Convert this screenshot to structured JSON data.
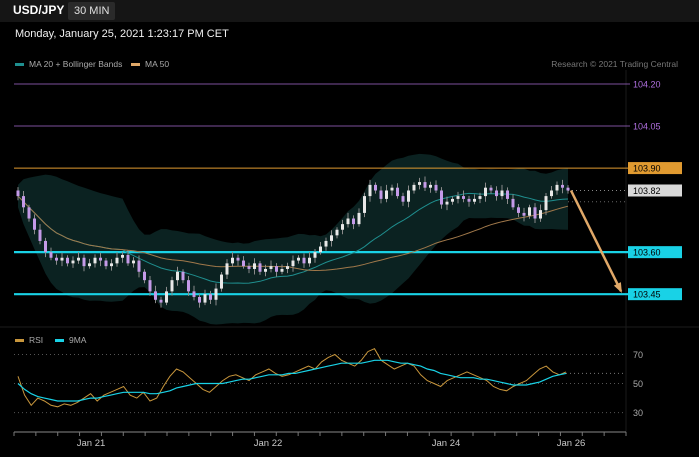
{
  "header": {
    "pair": "USD/JPY",
    "timeframe": "30 MIN"
  },
  "timestamp": "Monday, January 25, 2021 1:23:17 PM CET",
  "main_legend": [
    {
      "label": "MA 20 + Bollinger Bands",
      "color": "#1f8f8f"
    },
    {
      "label": "MA 50",
      "color": "#e0a868"
    }
  ],
  "credit": "Research © 2021 Trading Central",
  "rsi_legend": [
    {
      "label": "RSI",
      "color": "#c8963c"
    },
    {
      "label": "9MA",
      "color": "#19d2e6"
    }
  ],
  "x_axis_labels": [
    "Jan 21",
    "Jan 22",
    "Jan 24",
    "Jan 26"
  ],
  "chart_data": [
    {
      "type": "candlestick",
      "title": "USD/JPY",
      "timeframe": "30 MIN",
      "ylim": [
        103.34,
        104.25
      ],
      "levels": [
        {
          "value": 104.2,
          "label": "104.20",
          "color": "#b070e0",
          "style": "thin"
        },
        {
          "value": 104.05,
          "label": "104.05",
          "color": "#b070e0",
          "style": "thin"
        },
        {
          "value": 103.9,
          "label": "103.90",
          "color": "#e09a30",
          "style": "resistance"
        },
        {
          "value": 103.82,
          "label": "103.82",
          "color": "#cccccc",
          "style": "current"
        },
        {
          "value": 103.6,
          "label": "103.60",
          "color": "#19d2e6",
          "style": "support"
        },
        {
          "value": 103.45,
          "label": "103.45",
          "color": "#19d2e6",
          "style": "support"
        }
      ],
      "forecast_arrow": {
        "from": 103.82,
        "to": 103.45,
        "color": "#e0a868"
      },
      "closes": [
        103.8,
        103.76,
        103.72,
        103.68,
        103.64,
        103.6,
        103.58,
        103.57,
        103.58,
        103.56,
        103.57,
        103.58,
        103.55,
        103.56,
        103.58,
        103.57,
        103.55,
        103.56,
        103.58,
        103.59,
        103.56,
        103.57,
        103.53,
        103.5,
        103.46,
        103.43,
        103.42,
        103.46,
        103.5,
        103.53,
        103.5,
        103.46,
        103.44,
        103.42,
        103.45,
        103.43,
        103.47,
        103.52,
        103.56,
        103.58,
        103.57,
        103.55,
        103.54,
        103.56,
        103.53,
        103.54,
        103.55,
        103.53,
        103.54,
        103.55,
        103.57,
        103.58,
        103.56,
        103.58,
        103.6,
        103.62,
        103.64,
        103.66,
        103.68,
        103.7,
        103.72,
        103.7,
        103.74,
        103.8,
        103.84,
        103.82,
        103.79,
        103.82,
        103.83,
        103.8,
        103.78,
        103.82,
        103.84,
        103.85,
        103.83,
        103.84,
        103.82,
        103.77,
        103.78,
        103.79,
        103.8,
        103.79,
        103.78,
        103.79,
        103.8,
        103.83,
        103.82,
        103.8,
        103.82,
        103.79,
        103.76,
        103.74,
        103.73,
        103.76,
        103.72,
        103.75,
        103.8,
        103.82,
        103.84,
        103.83,
        103.82
      ]
    },
    {
      "type": "line",
      "title": "RSI",
      "series": [
        {
          "name": "RSI",
          "values": [
            55,
            42,
            35,
            40,
            38,
            35,
            34,
            36,
            35,
            37,
            40,
            43,
            38,
            42,
            44,
            46,
            48,
            42,
            40,
            44,
            38,
            40,
            48,
            55,
            60,
            58,
            54,
            50,
            46,
            44,
            48,
            52,
            55,
            56,
            54,
            52,
            56,
            58,
            60,
            57,
            55,
            56,
            58,
            60,
            62,
            60,
            65,
            68,
            70,
            66,
            64,
            62,
            66,
            72,
            74,
            66,
            63,
            60,
            62,
            64,
            62,
            56,
            52,
            50,
            48,
            52,
            54,
            56,
            58,
            56,
            54,
            52,
            48,
            46,
            45,
            48,
            50,
            52,
            56,
            60,
            62,
            58,
            56,
            58
          ]
        },
        {
          "name": "9MA",
          "values": [
            50,
            46,
            43,
            41,
            40,
            39,
            38,
            38,
            38,
            38,
            39,
            40,
            40,
            41,
            42,
            43,
            44,
            44,
            44,
            44,
            43,
            43,
            44,
            45,
            47,
            48,
            49,
            50,
            50,
            50,
            50,
            50,
            51,
            52,
            53,
            53,
            54,
            55,
            56,
            56,
            56,
            57,
            57,
            58,
            59,
            60,
            61,
            62,
            63,
            64,
            64,
            64,
            64,
            65,
            66,
            66,
            66,
            65,
            64,
            64,
            63,
            62,
            60,
            59,
            57,
            56,
            55,
            54,
            54,
            54,
            53,
            53,
            52,
            51,
            50,
            49,
            49,
            49,
            50,
            51,
            53,
            55,
            56,
            57
          ]
        }
      ],
      "levels": [
        70,
        50,
        30
      ],
      "ylim": [
        18,
        80
      ]
    }
  ]
}
